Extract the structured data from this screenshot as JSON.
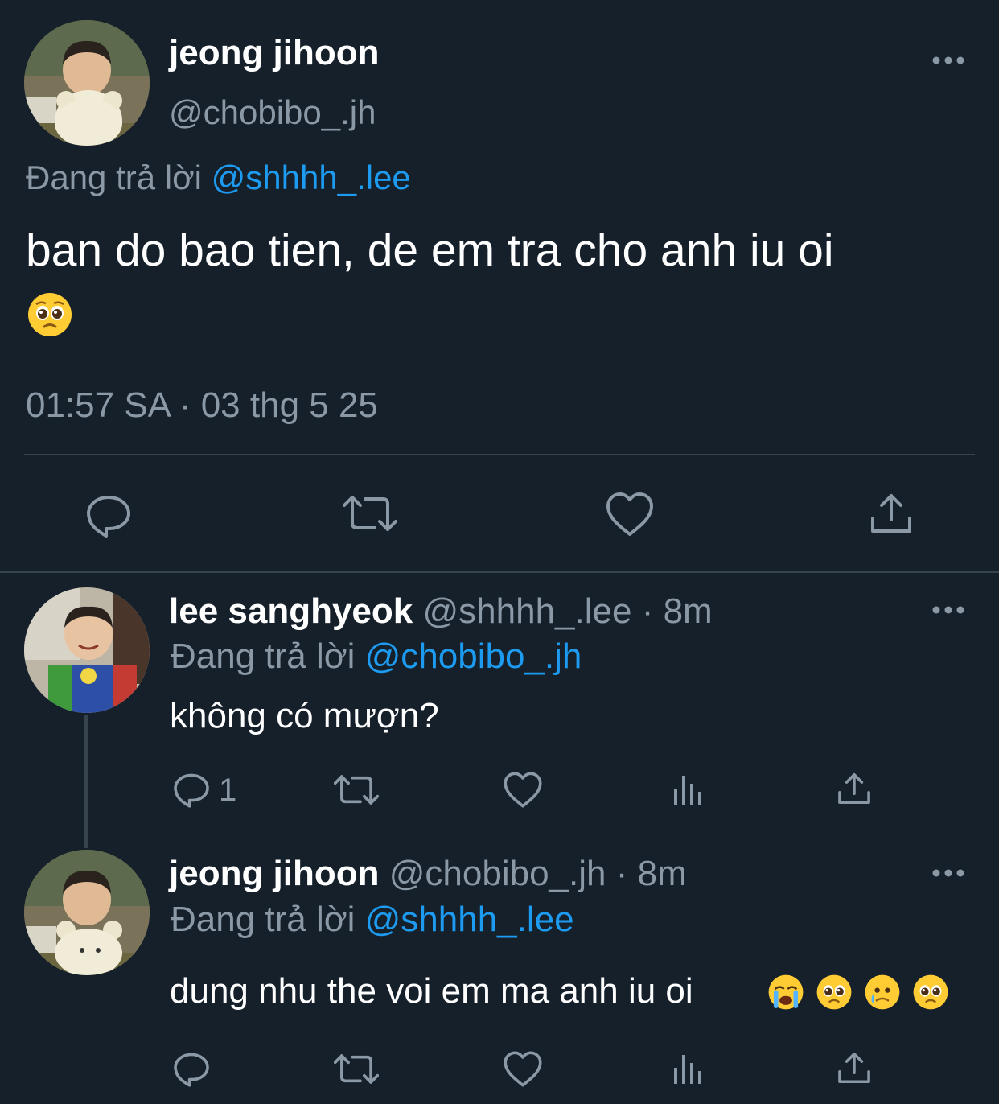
{
  "main_tweet": {
    "author_name": "jeong jihoon",
    "author_handle": "@chobibo_.jh",
    "replying_to_label": "Đang trả lời",
    "replying_to_handle": "@shhhh_.lee",
    "text": "ban do bao tien, de em tra cho anh iu oi",
    "emoji": "pleading-face",
    "timestamp": "01:57 SA · 03 thg 5 25",
    "actions": [
      "reply",
      "retweet",
      "like",
      "share"
    ]
  },
  "replies": [
    {
      "author_name": "lee sanghyeok",
      "author_handle": "@shhhh_.lee",
      "time_ago": "· 8m",
      "replying_to_label": "Đang trả lời",
      "replying_to_handle": "@chobibo_.jh",
      "text": "không có mượn?",
      "reply_count": "1",
      "actions": [
        "reply",
        "retweet",
        "like",
        "views",
        "share"
      ]
    },
    {
      "author_name": "jeong jihoon",
      "author_handle": "@chobibo_.jh",
      "time_ago": "· 8m",
      "replying_to_label": "Đang trả lời",
      "replying_to_handle": "@shhhh_.lee",
      "text": "dung nhu the voi em ma anh iu oi",
      "emojis": [
        "loudly-crying-face",
        "pleading-face",
        "face-holding-back-tears",
        "pleading-face"
      ],
      "actions": [
        "reply",
        "retweet",
        "like",
        "views",
        "share"
      ]
    }
  ],
  "colors": {
    "background": "#15202b",
    "text": "#ffffff",
    "secondary": "#8b98a5",
    "link": "#1d9bf0",
    "divider": "#38444d"
  }
}
